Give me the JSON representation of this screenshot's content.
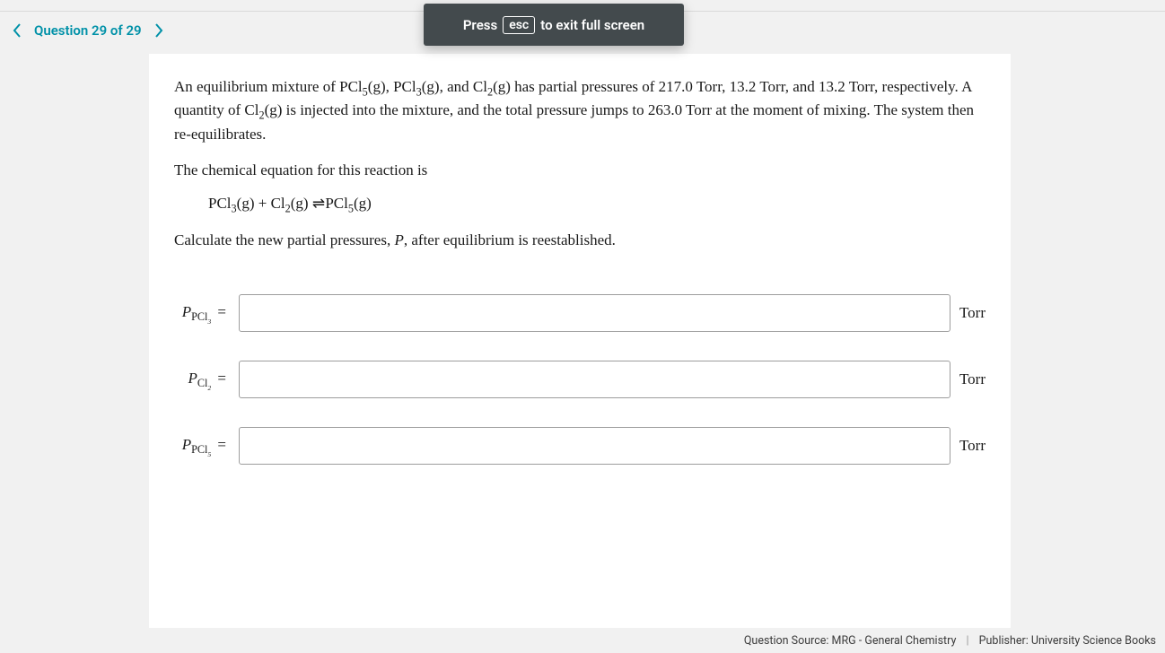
{
  "nav": {
    "question_label": "Question 29 of 29"
  },
  "overlay": {
    "press": "Press",
    "esc": "esc",
    "exit": "to exit full screen"
  },
  "problem": {
    "para1_a": "An equilibrium mixture of PCl",
    "para1_b": "(g), PCl",
    "para1_c": "(g), and Cl",
    "para1_d": "(g) has partial pressures of 217.0 Torr, 13.2 Torr, and 13.2 Torr, respectively. A quantity of Cl",
    "para1_e": "(g) is injected into the mixture, and the total pressure jumps to 263.0 Torr at the moment of mixing. The system then re‑equilibrates.",
    "para2": "The chemical equation for this reaction is",
    "eq_a": "PCl",
    "eq_b": "(g) + Cl",
    "eq_c": "(g) ",
    "eq_d": " PCl",
    "eq_e": "(g)",
    "para3_a": "Calculate the new partial pressures, ",
    "para3_b": ", after equilibrium is reestablished."
  },
  "answers": {
    "unit": "Torr",
    "row1_species": "PCl",
    "row1_sub": "3",
    "row2_species": "Cl",
    "row2_sub": "2",
    "row3_species": "PCl",
    "row3_sub": "5",
    "eq": "="
  },
  "footer": {
    "source_label": "Question Source:",
    "source_value": "MRG - General Chemistry",
    "publisher_label": "Publisher:",
    "publisher_value": "University Science Books"
  }
}
